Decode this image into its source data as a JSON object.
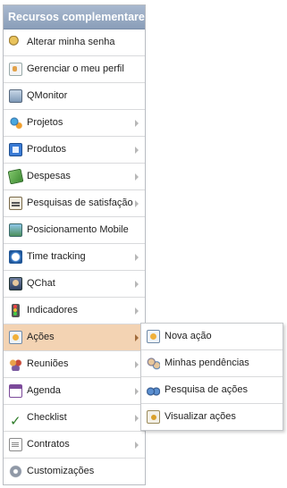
{
  "menu": {
    "header": "Recursos complementares",
    "items": [
      {
        "label": "Alterar minha senha",
        "icon": "key-icon",
        "has_submenu": false
      },
      {
        "label": "Gerenciar o meu perfil",
        "icon": "profile-icon",
        "has_submenu": false
      },
      {
        "label": "QMonitor",
        "icon": "monitor-icon",
        "has_submenu": false
      },
      {
        "label": "Projetos",
        "icon": "projects-icon",
        "has_submenu": true
      },
      {
        "label": "Produtos",
        "icon": "products-icon",
        "has_submenu": true
      },
      {
        "label": "Despesas",
        "icon": "money-icon",
        "has_submenu": true
      },
      {
        "label": "Pesquisas de satisfação",
        "icon": "survey-icon",
        "has_submenu": true
      },
      {
        "label": "Posicionamento Mobile",
        "icon": "mobile-map-icon",
        "has_submenu": false
      },
      {
        "label": "Time tracking",
        "icon": "clock-icon",
        "has_submenu": true
      },
      {
        "label": "QChat",
        "icon": "chat-icon",
        "has_submenu": true
      },
      {
        "label": "Indicadores",
        "icon": "traffic-light-icon",
        "has_submenu": true
      },
      {
        "label": "Ações",
        "icon": "actions-icon",
        "has_submenu": true,
        "active": true
      },
      {
        "label": "Reuniões",
        "icon": "meetings-icon",
        "has_submenu": true
      },
      {
        "label": "Agenda",
        "icon": "calendar-icon",
        "has_submenu": true
      },
      {
        "label": "Checklist",
        "icon": "checklist-icon",
        "has_submenu": true
      },
      {
        "label": "Contratos",
        "icon": "contract-icon",
        "has_submenu": true
      },
      {
        "label": "Customizações",
        "icon": "gear-icon",
        "has_submenu": false
      }
    ]
  },
  "submenu": {
    "items": [
      {
        "label": "Nova ação",
        "icon": "new-action-icon"
      },
      {
        "label": "Minhas pendências",
        "icon": "pending-icon"
      },
      {
        "label": "Pesquisa de ações",
        "icon": "binoculars-icon"
      },
      {
        "label": "Visualizar ações",
        "icon": "view-actions-icon"
      }
    ]
  },
  "colors": {
    "header_bg": "#97a9c2",
    "active_row": "#f3d3b3",
    "border": "#b9bcc2"
  }
}
